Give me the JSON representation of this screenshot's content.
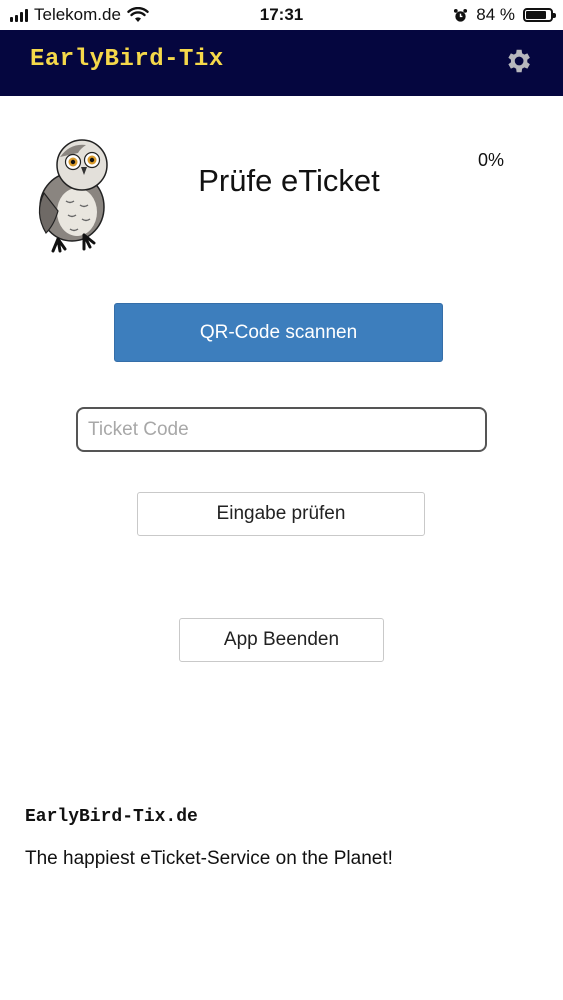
{
  "status_bar": {
    "carrier": "Telekom.de",
    "time": "17:31",
    "battery_percent": "84 %",
    "battery_level": 0.84,
    "icons": [
      "signal-icon",
      "wifi-icon",
      "alarm-icon",
      "battery-icon"
    ]
  },
  "header": {
    "brand": "EarlyBird-Tix",
    "settings_icon": "gear-icon",
    "colors": {
      "background": "#05063f",
      "brand_text": "#f5d84a"
    }
  },
  "main": {
    "logo": "owl-logo",
    "title": "Prüfe eTicket",
    "progress": "0%",
    "scan_button": "QR-Code scannen",
    "ticket_input": {
      "placeholder": "Ticket Code",
      "value": ""
    },
    "check_button": "Eingabe prüfen",
    "quit_button": "App Beenden",
    "colors": {
      "primary_button": "#3d7ebd"
    }
  },
  "footer": {
    "brand": "EarlyBird-Tix.de",
    "tagline": "The happiest eTicket-Service on the Planet!"
  }
}
